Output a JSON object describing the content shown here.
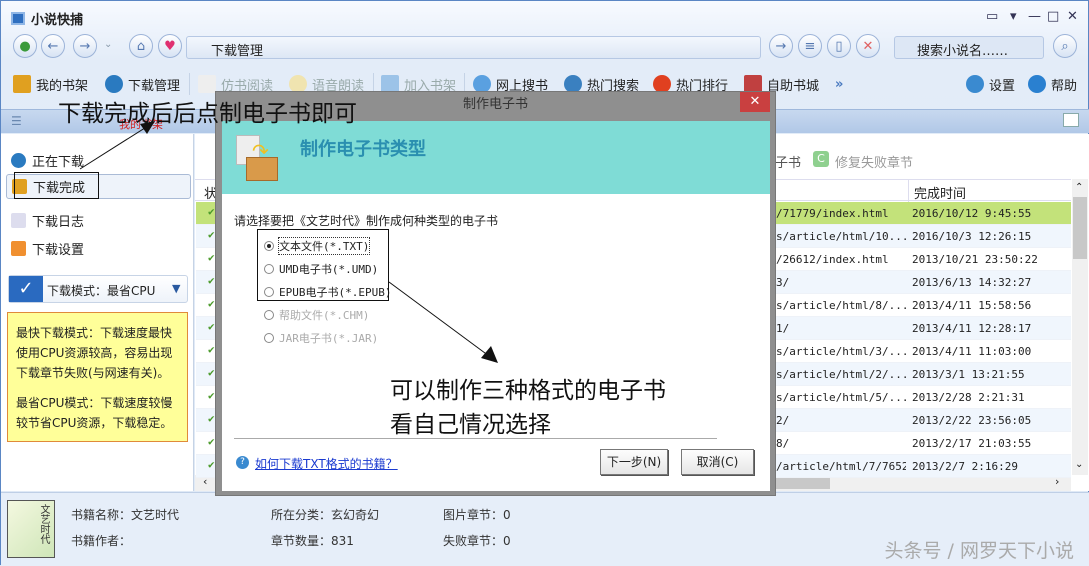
{
  "app": {
    "title": "小说快捕"
  },
  "address": {
    "value": "下载管理"
  },
  "search": {
    "placeholder": "搜索小说名……"
  },
  "toolbar": {
    "items": [
      "我的书架",
      "下载管理",
      "仿书阅读",
      "语音朗读",
      "加入书架",
      "网上搜书",
      "热门搜索",
      "热门排行",
      "自助书城"
    ],
    "more": "»",
    "settings": "设置",
    "help": "帮助"
  },
  "pane": {
    "crumb": "我的书架"
  },
  "sidebar": {
    "items": [
      "正在下载",
      "下载完成",
      "下载日志",
      "下载设置"
    ],
    "mode": "下载模式：最省CPU",
    "note1": "最快下载模式：下载速度最快使用CPU资源较高，容易出现下载章节失败(与网速有关)。",
    "note2": "最省CPU模式：下载速度较慢较节省CPU资源，下载稳定。"
  },
  "main": {
    "actions": {
      "make_ebook": "制作电子书",
      "repair": "修复失败章节"
    },
    "columns": {
      "status": "状",
      "finish_time": "完成时间"
    },
    "rows": [
      {
        "url": "/71779/index.html",
        "time": "2016/10/12 9:45:55"
      },
      {
        "url": "s/article/html/10...",
        "time": "2016/10/3 12:26:15"
      },
      {
        "url": "/26612/index.html",
        "time": "2013/10/21 23:50:22"
      },
      {
        "url": "3/",
        "time": "2013/6/13 14:32:27"
      },
      {
        "url": "s/article/html/8/...",
        "time": "2013/4/11 15:58:56"
      },
      {
        "url": "1/",
        "time": "2013/4/11 12:28:17"
      },
      {
        "url": "s/article/html/3/...",
        "time": "2013/4/11 11:03:00"
      },
      {
        "url": "s/article/html/2/...",
        "time": "2013/3/1 13:21:55"
      },
      {
        "url": "s/article/html/5/...",
        "time": "2013/2/28 2:21:31"
      },
      {
        "url": "2/",
        "time": "2013/2/22 23:56:05"
      },
      {
        "url": "8/",
        "time": "2013/2/17 21:03:55"
      },
      {
        "url": "/article/html/7/7652/",
        "time": "2013/2/7 2:16:29"
      }
    ]
  },
  "book": {
    "name": "书籍名称：文艺时代",
    "author": "书籍作者：",
    "category": "所在分类：玄幻奇幻",
    "chapters": "章节数量：831",
    "image_chapters": "图片章节：0",
    "failed_chapters": "失败章节：0",
    "cover_text": "文艺时代"
  },
  "dialog": {
    "title": "制作电子书",
    "heading": "制作电子书类型",
    "prompt": "请选择要把《文艺时代》制作成何种类型的电子书",
    "options": [
      "文本文件(*.TXT)",
      "UMD电子书(*.UMD)",
      "EPUB电子书(*.EPUB)",
      "帮助文件(*.CHM)",
      "JAR电子书(*.JAR)"
    ],
    "help_link": "如何下载TXT格式的书籍？",
    "next": "下一步(N)",
    "cancel": "取消(C)"
  },
  "annotations": {
    "top": "下载完成后后点制电子书即可",
    "line1": "可以制作三种格式的电子书",
    "line2": "看自己情况选择"
  },
  "watermark": "头条号 / 网罗天下小说"
}
